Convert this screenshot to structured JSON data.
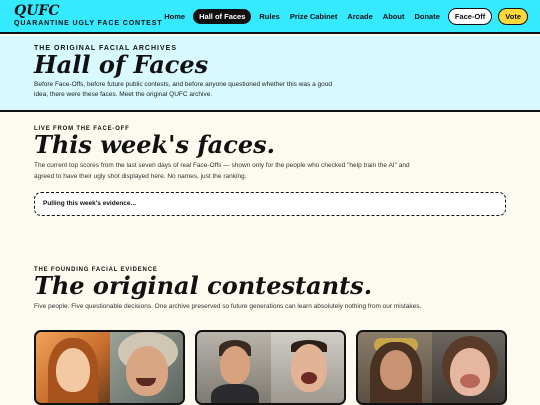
{
  "header": {
    "logo": "QUFC",
    "tagline": "QUARANTINE UGLY FACE CONTEST",
    "nav": [
      {
        "label": "Home",
        "active": false
      },
      {
        "label": "Hall of Faces",
        "active": true
      },
      {
        "label": "Rules",
        "active": false
      },
      {
        "label": "Prize Cabinet",
        "active": false
      },
      {
        "label": "Arcade",
        "active": false
      },
      {
        "label": "About",
        "active": false
      },
      {
        "label": "Donate",
        "active": false
      }
    ],
    "faceoff_label": "Face-Off",
    "vote_label": "Vote"
  },
  "hero": {
    "eyebrow": "THE ORIGINAL FACIAL ARCHIVES",
    "title": "Hall of Faces",
    "description": "Before Face-Offs, before future public contests, and before anyone questioned whether this was a good idea, there were these faces. Meet the original QUFC archive."
  },
  "weekly": {
    "eyebrow": "LIVE FROM THE FACE-OFF",
    "title": "This week's faces.",
    "description": "The current top scores from the last seven days of real Face-Offs — shown only for the people who checked \"help train the AI\" and agreed to have their ugly shot displayed here. No names, just the ranking.",
    "loading": "Pulling this week's evidence..."
  },
  "original": {
    "eyebrow": "THE FOUNDING FACIAL EVIDENCE",
    "title": "The original contestants.",
    "description": "Five people. Five questionable decisions. One archive preserved so future generations can learn absolutely nothing from our mistakes."
  },
  "colors": {
    "header_bg": "#35e9ff",
    "hero_bg": "#d8f9ff",
    "page_bg": "#fdfaf0",
    "vote_bg": "#ffd93b"
  }
}
